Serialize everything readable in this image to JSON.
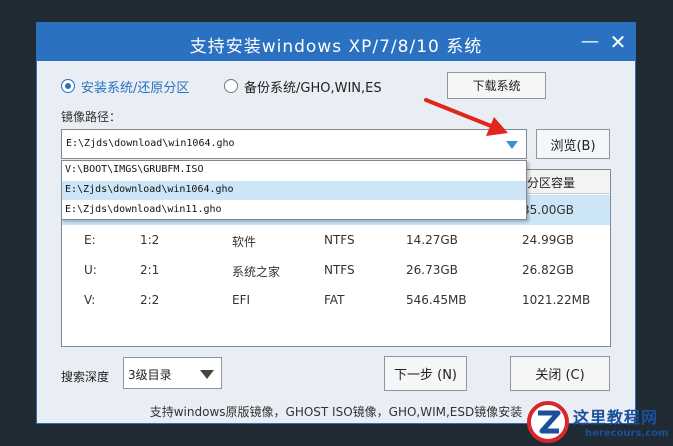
{
  "window": {
    "title": "支持安装windows XP/7/8/10 系统",
    "minimize_glyph": "—",
    "close_glyph": "✕"
  },
  "mode": {
    "install_label": "安装系统/还原分区",
    "backup_label": "备份系统/GHO,WIN,ES",
    "selected": "install"
  },
  "download_button": "下载系统",
  "image_path": {
    "label": "镜像路径：",
    "value": "E:\\Zjds\\download\\win1064.gho",
    "browse_label": "浏览(B)"
  },
  "dropdown": {
    "options": [
      "V:\\BOOT\\IMGS\\GRUBFM.ISO",
      "E:\\Zjds\\download\\win1064.gho",
      "E:\\Zjds\\download\\win11.gho"
    ],
    "highlighted_index": 1
  },
  "partition_table": {
    "visible_header": "分区容量",
    "rows": [
      {
        "drive": "",
        "partition": "",
        "label": "",
        "fs": "",
        "free": "",
        "capacity": "35.00GB",
        "selected": true
      },
      {
        "drive": "E:",
        "partition": "1:2",
        "label": "软件",
        "fs": "NTFS",
        "free": "14.27GB",
        "capacity": "24.99GB",
        "selected": false
      },
      {
        "drive": "U:",
        "partition": "2:1",
        "label": "系统之家",
        "fs": "NTFS",
        "free": "26.73GB",
        "capacity": "26.82GB",
        "selected": false
      },
      {
        "drive": "V:",
        "partition": "2:2",
        "label": "EFI",
        "fs": "FAT",
        "free": "546.45MB",
        "capacity": "1021.22MB",
        "selected": false
      }
    ]
  },
  "search_depth": {
    "label": "搜索深度",
    "value": "3级目录"
  },
  "buttons": {
    "next": "下一步 (N)",
    "close": "关闭 (C)"
  },
  "footer": "支持windows原版镜像，GHOST ISO镜像，GHO,WIM,ESD镜像安装",
  "watermark": {
    "name": "这里教程网",
    "url": "herecours.com"
  },
  "colors": {
    "accent": "#2a72c1",
    "selection": "#cde6f7",
    "annotation_arrow": "#e0261d",
    "dropdown_arrow": "#3a8fd8"
  }
}
